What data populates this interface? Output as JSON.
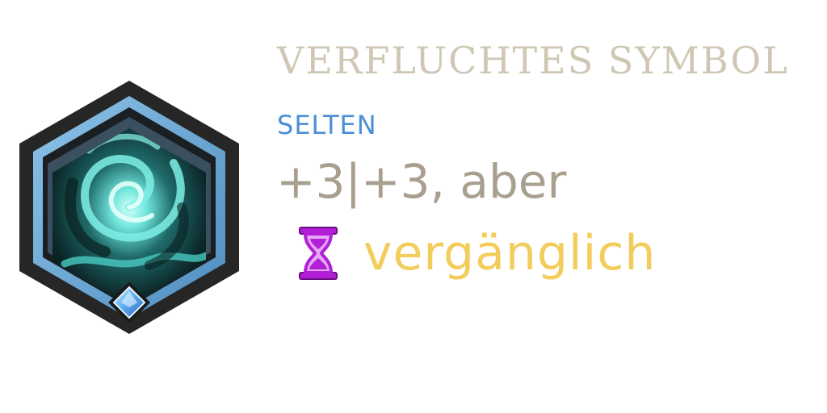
{
  "item": {
    "name": "VERFLUCHTES SYMBOL",
    "rarity": "SELTEN",
    "stat_text": "+3|+3, aber",
    "effect_text": "vergänglich",
    "icon": "cursed-swirl-emblem-icon",
    "effect_icon": "hourglass-icon"
  },
  "colors": {
    "title": "#cfc7b4",
    "rarity": "#4a90d6",
    "stat": "#a89f8f",
    "effect": "#f2cd5c",
    "hourglass": "#b21fd6",
    "frame_outer": "#2a2a2a",
    "frame_blue": "#6aa7d4",
    "swirl": "#58e0d8",
    "gem": "#5aa8f0"
  }
}
